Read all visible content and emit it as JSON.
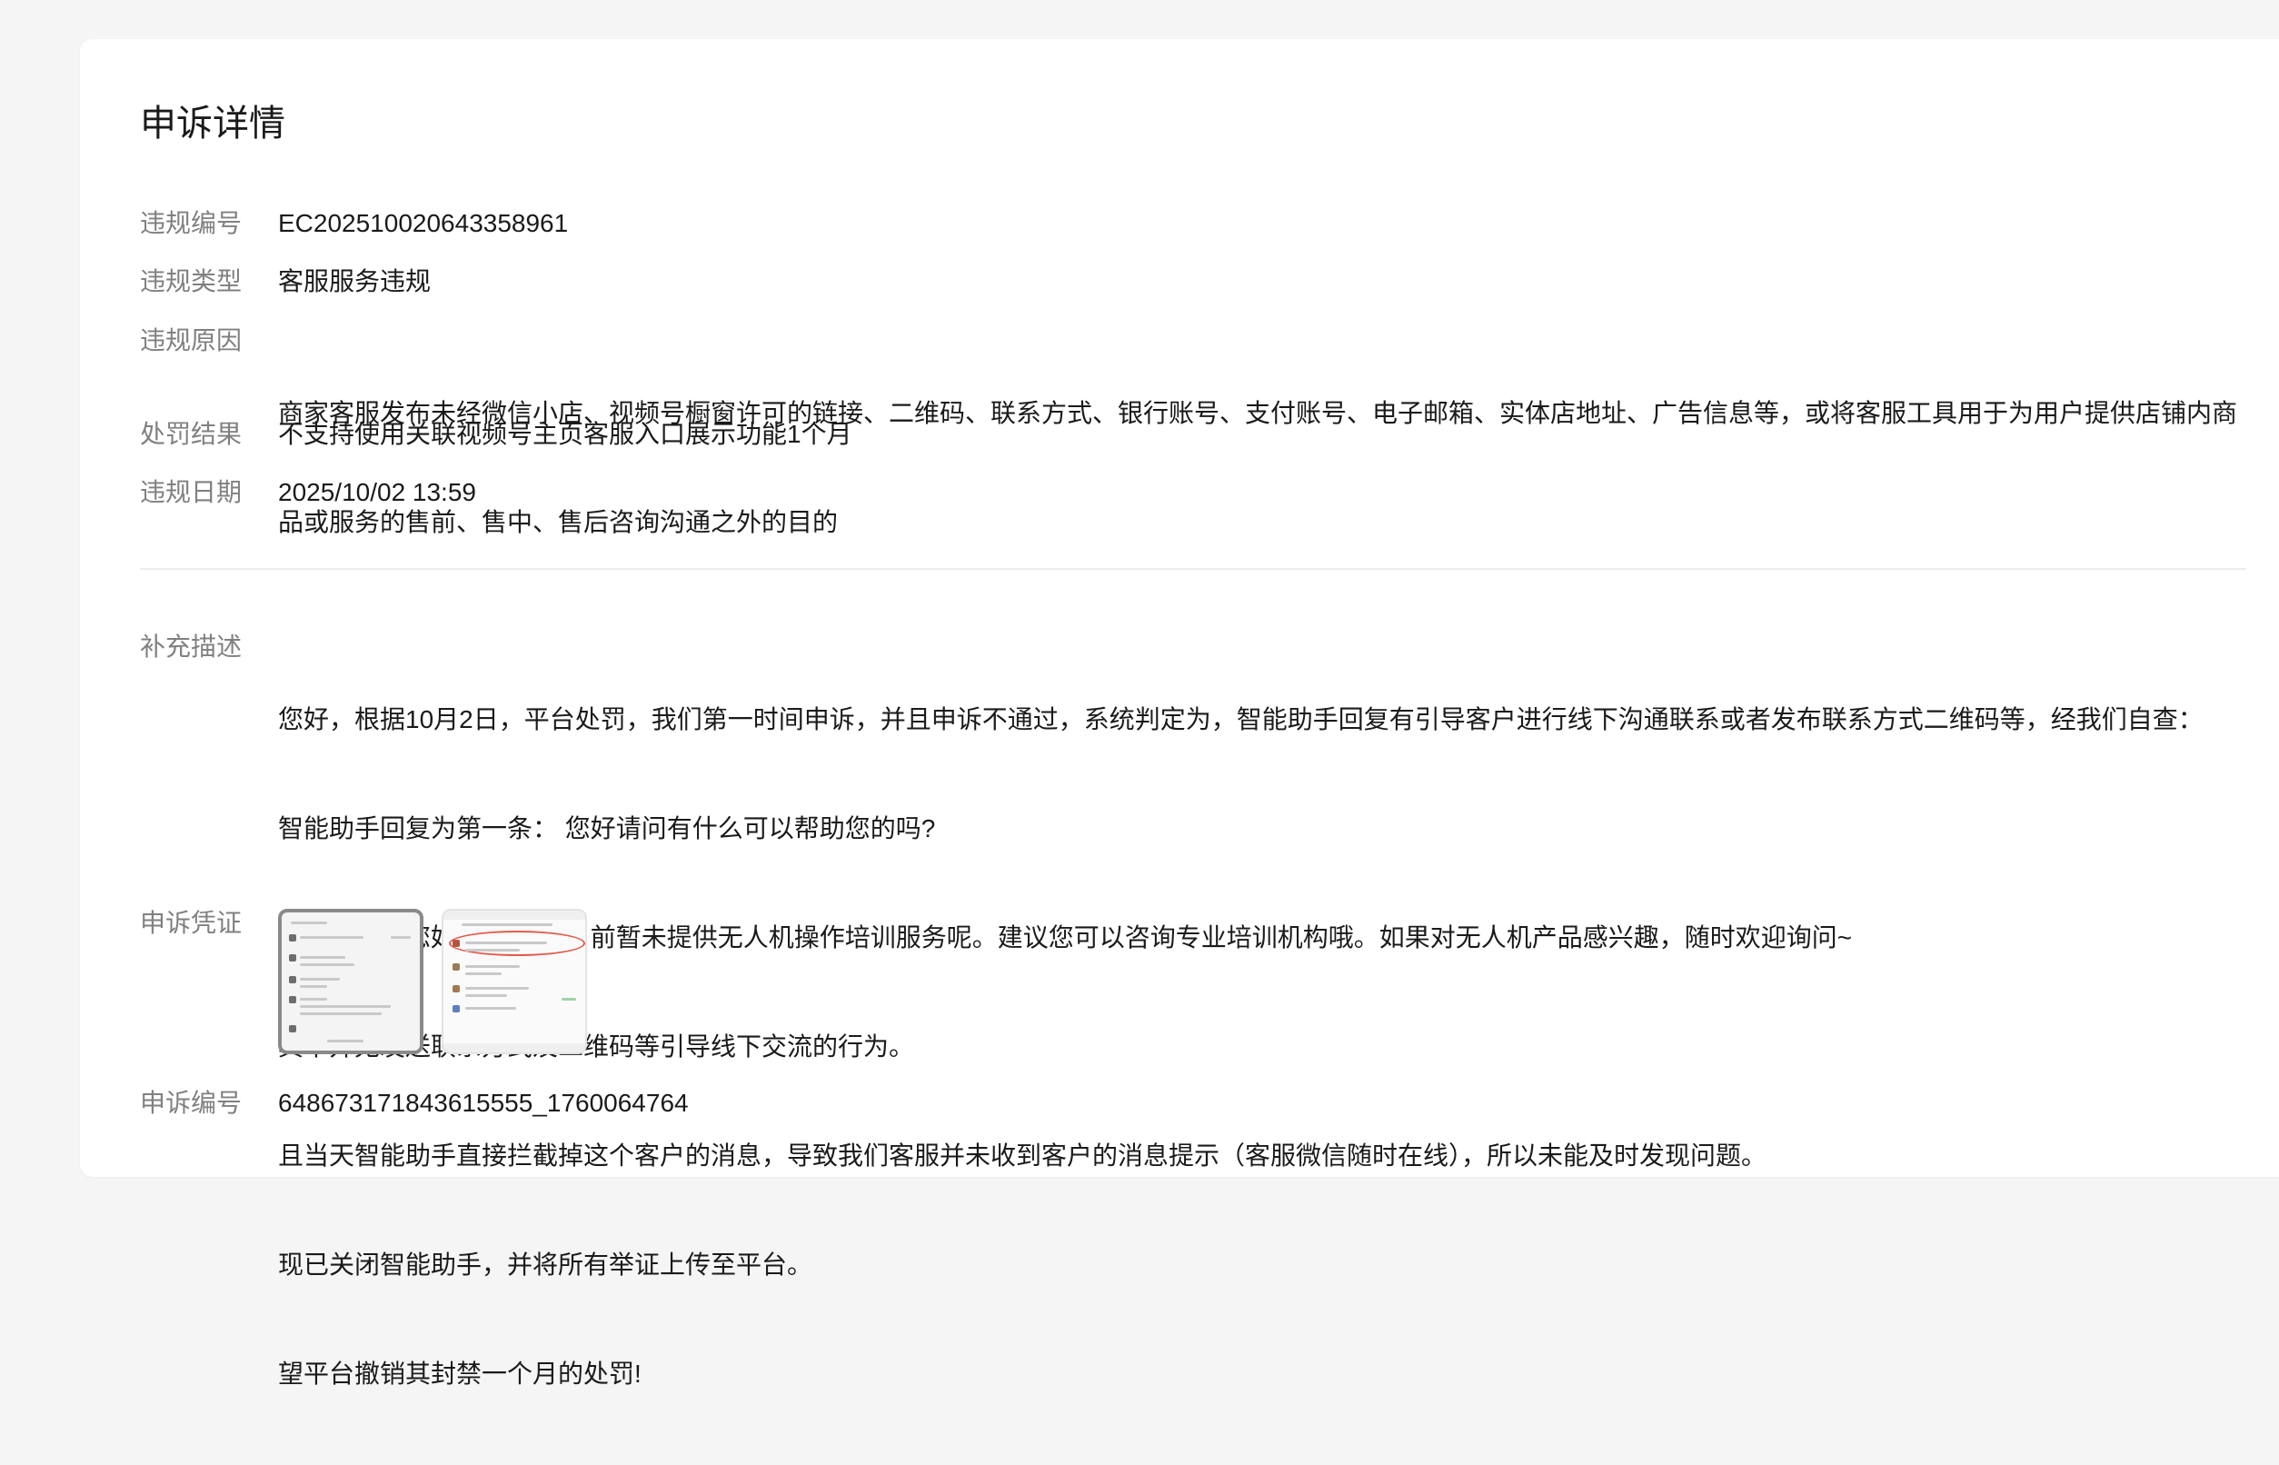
{
  "title": "申诉详情",
  "violation": {
    "id_label": "违规编号",
    "id_value": "EC202510020643358961",
    "type_label": "违规类型",
    "type_value": "客服服务违规",
    "reason_label": "违规原因",
    "reason_line1": "商家客服发布未经微信小店、视频号橱窗许可的链接、二维码、联系方式、银行账号、支付账号、电子邮箱、实体店地址、广告信息等，或将客服工具用于为用户提供店铺内商",
    "reason_line2": "品或服务的售前、售中、售后咨询沟通之外的目的",
    "penalty_label": "处罚结果",
    "penalty_value": "不支持使用关联视频号主页客服入口展示功能1个月",
    "date_label": "违规日期",
    "date_value": "2025/10/02 13:59"
  },
  "appeal": {
    "desc_label": "补充描述",
    "desc_lines": [
      "您好，根据10月2日，平台处罚，我们第一时间申诉，并且申诉不通过，系统判定为，智能助手回复有引导客户进行线下沟通联系或者发布联系方式二维码等，经我们自查：",
      "智能助手回复为第一条： 您好请问有什么可以帮助您的吗?",
      "第二条为：您好!我们小店目前暂未提供无人机操作培训服务呢。建议您可以咨询专业培训机构哦。如果对无人机产品感兴趣，随时欢迎询问~",
      "其中并无发送联系方式及二维码等引导线下交流的行为。",
      "且当天智能助手直接拦截掉这个客户的消息，导致我们客服并未收到客户的消息提示（客服微信随时在线），所以未能及时发现问题。",
      "现已关闭智能助手，并将所有举证上传至平台。",
      "望平台撤销其封禁一个月的处罚!"
    ],
    "evidence_label": "申诉凭证",
    "evidence_images": [
      "evidence-image-1",
      "evidence-image-2"
    ],
    "appeal_id_label": "申诉编号",
    "appeal_id_value": "648673171843615555_1760064764"
  }
}
